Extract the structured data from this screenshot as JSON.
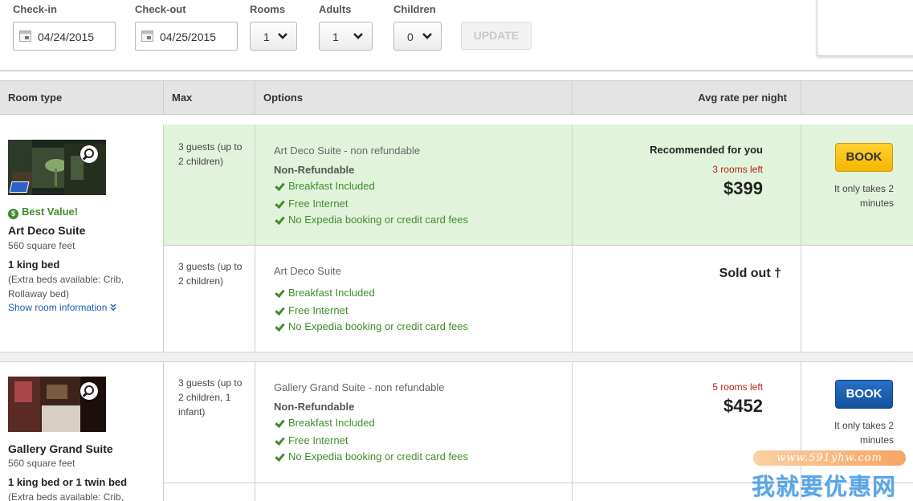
{
  "search": {
    "checkin_label": "Check-in",
    "checkin_value": "04/24/2015",
    "checkout_label": "Check-out",
    "checkout_value": "04/25/2015",
    "rooms_label": "Rooms",
    "rooms_value": "1",
    "adults_label": "Adults",
    "adults_value": "1",
    "children_label": "Children",
    "children_value": "0",
    "update_label": "UPDATE"
  },
  "table": {
    "headers": {
      "room_type": "Room type",
      "max": "Max",
      "options": "Options",
      "rate": "Avg rate per night"
    }
  },
  "rooms": [
    {
      "best_value": "Best Value!",
      "name": "Art Deco Suite",
      "size": "560 square feet",
      "bed": "1 king bed",
      "extra_beds": "(Extra beds available: Crib, Rollaway bed)",
      "show_info": "Show room information",
      "rates": [
        {
          "max": "3 guests (up to 2 children)",
          "title": "Art Deco Suite - non refundable",
          "subtitle": "Non-Refundable",
          "features": [
            "Breakfast Included",
            "Free Internet",
            "No Expedia booking or credit card fees"
          ],
          "recommended": "Recommended for you",
          "rooms_left": "3 rooms left",
          "price": "$399",
          "book_label": "BOOK",
          "book_note": "It only takes 2 minutes"
        },
        {
          "max": "3 guests (up to 2 children)",
          "title": "Art Deco Suite",
          "features": [
            "Breakfast Included",
            "Free Internet",
            "No Expedia booking or credit card fees"
          ],
          "sold_out": "Sold out †"
        }
      ]
    },
    {
      "name": "Gallery Grand Suite",
      "size": "560 square feet",
      "bed": "1 king bed or 1 twin bed",
      "extra_beds": "(Extra beds available: Crib,",
      "rates": [
        {
          "max": "3 guests (up to 2 children, 1 infant)",
          "title": "Gallery Grand Suite - non refundable",
          "subtitle": "Non-Refundable",
          "features": [
            "Breakfast Included",
            "Free Internet",
            "No Expedia booking or credit card fees"
          ],
          "rooms_left": "5 rooms left",
          "price": "$452",
          "book_label": "BOOK",
          "book_note": "It only takes 2 minutes"
        }
      ]
    }
  ],
  "watermark": {
    "url": "www.591yhw.com",
    "text": "我就要优惠网"
  },
  "icons": [
    "calendar-icon",
    "chevron-down-icon",
    "zoom-icon",
    "dollar-coin-icon",
    "checkmark-icon",
    "double-chevron-down-icon"
  ],
  "colors": {
    "highlight_row": "#e2f3dc",
    "feature_green": "#3e8d2a",
    "rooms_left_red": "#b5221a",
    "book_yellow": "#ffd12e",
    "book_blue": "#13519f",
    "link_blue": "#1a5fb0"
  }
}
